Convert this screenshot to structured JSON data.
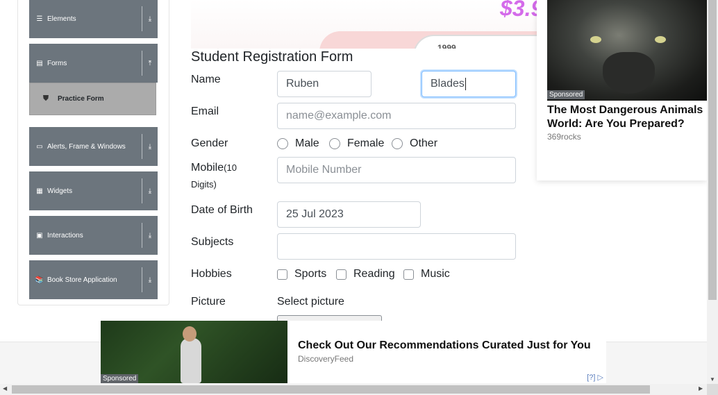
{
  "sidebar": {
    "groups": [
      {
        "label": "Elements",
        "icon": "hamburger-icon"
      },
      {
        "label": "Forms",
        "icon": "document-icon"
      },
      {
        "label": "Alerts, Frame & Windows",
        "icon": "window-icon"
      },
      {
        "label": "Widgets",
        "icon": "grid-icon"
      },
      {
        "label": "Interactions",
        "icon": "list-icon"
      },
      {
        "label": "Book Store Application",
        "icon": "books-icon"
      }
    ],
    "active_item": {
      "label": "Practice Form",
      "icon": "html5-icon"
    }
  },
  "banner_top": {
    "price": "$3.9",
    "number": "1999"
  },
  "form": {
    "title": "Student Registration Form",
    "name_label": "Name",
    "first_name": "Ruben",
    "last_name": "Blades",
    "email_label": "Email",
    "email_placeholder": "name@example.com",
    "gender_label": "Gender",
    "genders": [
      "Male",
      "Female",
      "Other"
    ],
    "mobile_label": "Mobile",
    "mobile_hint": "(10 Digits)",
    "mobile_placeholder": "Mobile Number",
    "dob_label": "Date of Birth",
    "dob_value": "25 Jul 2023",
    "subjects_label": "Subjects",
    "subjects_value": "",
    "hobbies_label": "Hobbies",
    "hobbies": [
      "Sports",
      "Reading",
      "Music"
    ],
    "picture_label": "Picture",
    "picture_button": "Select picture"
  },
  "ad_right": {
    "sponsored": "Sponsored",
    "headline_line1": "The Most Dangerous Animals",
    "headline_line2": "World: Are You Prepared?",
    "source": "369rocks"
  },
  "ad_bottom": {
    "sponsored": "Sponsored",
    "headline": "Check Out Our Recommendations Curated Just for You",
    "source": "DiscoveryFeed",
    "adchoice": "[?]"
  }
}
